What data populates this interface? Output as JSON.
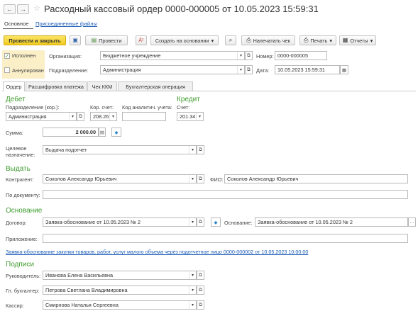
{
  "window": {
    "title": "Расходный кассовый ордер 0000-000005 от 10.05.2023 15:59:31",
    "back_icon": "←",
    "forward_icon": "→",
    "star_icon": "☆"
  },
  "page_tabs": {
    "main": "Основное",
    "files": "Присоединенные файлы"
  },
  "toolbar": {
    "post_close": "Провести и закрыть",
    "post": "Провести",
    "create_based": "Создать на основании",
    "print_check": "Напечатать чек",
    "print": "Печать",
    "reports": "Отчеты",
    "dropdown_icon": "▾"
  },
  "header": {
    "executed_label": "Исполнен",
    "executed_checked": "✓",
    "cancelled_label": "Аннулирован",
    "org_label": "Организация:",
    "org_value": "Бюджетное учреждение",
    "number_label": "Номер:",
    "number_value": "0000-000005",
    "dept_label": "Подразделение:",
    "dept_value": "Администрация",
    "date_label": "Дата:",
    "date_value": "10.05.2023 15:59:31"
  },
  "tabs": [
    "Ордер",
    "Расшифровка платежа",
    "Чек ККМ",
    "Бухгалтерская операция"
  ],
  "debit": {
    "heading": "Дебет",
    "dept_label": "Подразделение (кор.):",
    "dept_value": "Администрация",
    "corr_label": "Кор. счет:",
    "corr_value": "208.26",
    "kau_label": "Код аналитич. учета:",
    "kau_value": ""
  },
  "credit": {
    "heading": "Кредит",
    "acc_label": "Счет:",
    "acc_value": "201.34"
  },
  "amount": {
    "label": "Сумма:",
    "value": "2 000.00"
  },
  "purpose": {
    "label1": "Целевое",
    "label2": "назначение:",
    "value": "Выдача подотчет"
  },
  "issue": {
    "heading": "Выдать",
    "counterparty_label": "Контрагент:",
    "counterparty_value": "Соколов Александр Юрьевич",
    "fio_label": "ФИО:",
    "fio_value": "Соколов Александр Юрьевич",
    "doc_label": "По документу:",
    "doc_value": ""
  },
  "basis": {
    "heading": "Основание",
    "contract_label": "Договор:",
    "contract_value": "Заявка-обоснование от 10.05.2023 № 2",
    "basis_label": "Основание:",
    "basis_value": "Заявка-обоснование от 10.05.2023 № 2",
    "attach_label": "Приложение:",
    "attach_value": "",
    "link": "Заявка-обоснование закупки товаров, работ, услуг малого объема через подотчетное лицо 0000-000002 от 10.05.2023 10:00:00"
  },
  "signs": {
    "heading": "Подписи",
    "head_label": "Руководитель:",
    "head_value": "Иванова Елена Васильевна",
    "chief_label": "Гл. бухгалтер:",
    "chief_value": "Петрова Светлана Владимировна",
    "cashier_label": "Кассир:",
    "cashier_value": "Смирнова Наталья Сергеевна"
  },
  "colors": {
    "accent_green": "#3e9b2e",
    "button_yellow": "#f2cc1f",
    "link_blue": "#1a5bb5"
  }
}
